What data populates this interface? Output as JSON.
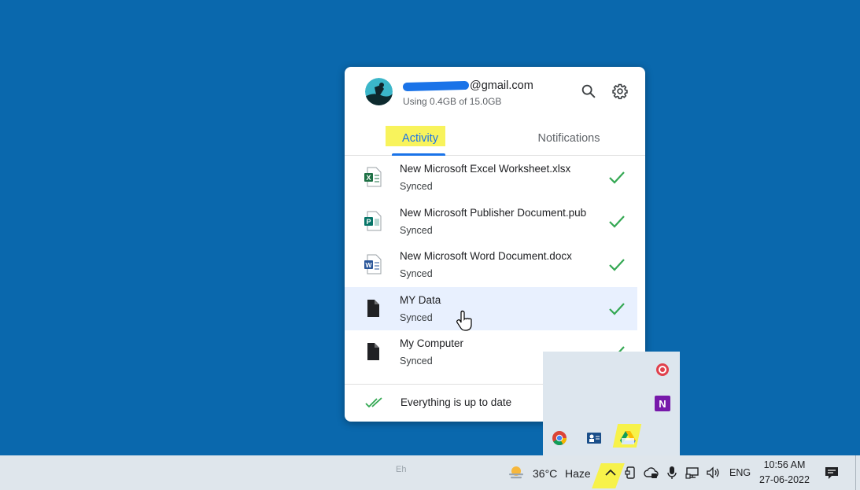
{
  "account": {
    "email_suffix": "@gmail.com",
    "storage": "Using 0.4GB of 15.0GB"
  },
  "tabs": [
    {
      "label": "Activity",
      "active": true
    },
    {
      "label": "Notifications",
      "active": false
    }
  ],
  "files": [
    {
      "name": "New Microsoft Excel Worksheet.xlsx",
      "status": "Synced",
      "icon": "excel-file-icon"
    },
    {
      "name": "New Microsoft Publisher Document.pub",
      "status": "Synced",
      "icon": "publisher-file-icon"
    },
    {
      "name": "New Microsoft Word Document.docx",
      "status": "Synced",
      "icon": "word-file-icon"
    },
    {
      "name": "MY Data",
      "status": "Synced",
      "icon": "generic-file-icon"
    },
    {
      "name": "My Computer",
      "status": "Synced",
      "icon": "generic-file-icon"
    }
  ],
  "footer": {
    "message": "Everything is up to date"
  },
  "taskbar": {
    "center_text": "Eh",
    "weather_temp": "36°C",
    "weather_desc": "Haze",
    "language": "ENG",
    "time": "10:56 AM",
    "date": "27-06-2022"
  },
  "colors": {
    "desktop": "#0a68ad",
    "accent": "#1a73e8",
    "check": "#34a853",
    "highlight": "#f7f24a"
  }
}
